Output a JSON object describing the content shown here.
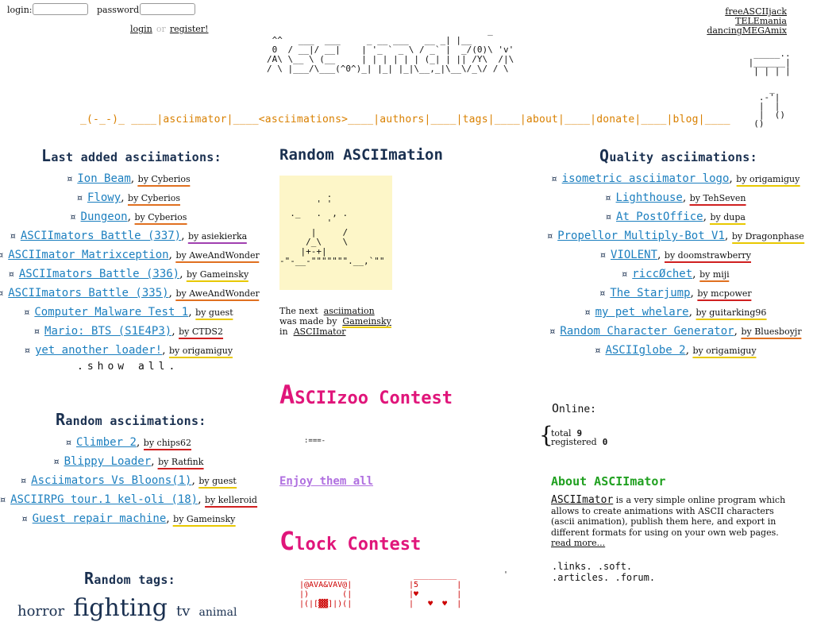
{
  "login": {
    "login_label": "login:",
    "password_label": "password:",
    "login_link": "login",
    "or_text": "or",
    "register_link": "register!"
  },
  "top_right_links": [
    "freeASCIIjack",
    "TELEmania",
    "dancingMEGAmix"
  ],
  "logo_art": "                                          _\n ^^   ___  ___     _ __ ___   __ _| |__\n 0  / __|/ __|    | '_ ` _ \\ / _` |  _/(0)\\ 'v'\n/A\\ \\__ \\ (__     | | | | | | (_| | || /Y\\  /|\\\n/ \\ |___/\\___(^0^)_| |_| |_|\\__,_|\\__\\/_\\/ / \\",
  "right_art": "  _____..\n |______|\n  | | | |\n\n     _\n   .-'|\n   |  |\n   |  ()\n  ()",
  "menu": {
    "face": "_(-_-)_",
    "sep": "____|",
    "items": [
      "asciimator|",
      "____<asciimations>",
      "____|authors|",
      "____|tags|",
      "____|about|",
      "____|donate|",
      "____|blog|",
      "____"
    ]
  },
  "last_added": {
    "heading_cap": "L",
    "heading_rest": "ast added asciimations:",
    "items": [
      {
        "title": "Ion Beam",
        "by": "by Cyberios"
      },
      {
        "title": "Flowy",
        "by": "by Cyberios"
      },
      {
        "title": "Dungeon",
        "by": "by Cyberios"
      },
      {
        "title": "ASCIImators Battle (337)",
        "by": "by asiekierka"
      },
      {
        "title": "ASCIImator Matrixception",
        "by": "by AweAndWonder"
      },
      {
        "title": "ASCIImators Battle (336)",
        "by": "by Gameinsky"
      },
      {
        "title": "ASCIImators Battle (335)",
        "by": "by AweAndWonder"
      },
      {
        "title": "Computer Malware Test 1",
        "by": "by guest"
      },
      {
        "title": "Mario: BTS (S1E4P3)",
        "by": "by CTDS2"
      },
      {
        "title": "yet another loader!",
        "by": "by origamiguy"
      }
    ],
    "show_all": ".show all."
  },
  "random_asciimations": {
    "heading_cap": "R",
    "heading_rest": "andom asciimations:",
    "items": [
      {
        "title": "Climber 2",
        "by": "by chips62"
      },
      {
        "title": "Blippy Loader",
        "by": "by Ratfink"
      },
      {
        "title": "Asciimators Vs Bloons(1)",
        "by": "by guest"
      },
      {
        "title": "ASCIIRPG tour.1 kel-oli (18)",
        "by": "by kelleroid"
      },
      {
        "title": "Guest repair machine",
        "by": "by Gameinsky"
      }
    ]
  },
  "random_tags": {
    "heading_cap": "R",
    "heading_rest": "andom tags:",
    "tags": [
      "horror",
      "fighting",
      "tv",
      "animal"
    ]
  },
  "random_asciimation": {
    "heading": "Random ASCIImation",
    "art": "\n         .\n       ' '\n  ._   .  , .\n         '\n      |     /\n     /_\\    \\\n    |+-+|\n-\"-__-\"\"\"\"\"\"\".__,`\"\"",
    "next_prefix": "The next",
    "next_link": "asciimation",
    "made_by_prefix": "was made by",
    "made_by_link": "Gameinsky",
    "in_prefix": "in",
    "in_link": "ASCIImator"
  },
  "zoo_contest": {
    "cap": "A",
    "rest": "SCIIzoo Contest",
    "art": ":===-",
    "enjoy": "Enjoy them all"
  },
  "clock_contest": {
    "cap": "C",
    "rest": "lock Contest",
    "art1": " _________\n|@AVA&VAV@|\n|)       (|\n|(|[▓▓]|)(|",
    "art2": " _________\n|5        |\n|♥        |\n|   ♥  ♥  |",
    "art3": "'"
  },
  "quality": {
    "heading_cap": "Q",
    "heading_rest": "uality asciimations:",
    "items": [
      {
        "title": "isometric asciimator logo",
        "by": "by origamiguy"
      },
      {
        "title": "Lighthouse",
        "by": "by TehSeven"
      },
      {
        "title": "At PostOffice",
        "by": "by dupa"
      },
      {
        "title": "Propellor Multiply-Bot V1",
        "by": "by Dragonphase"
      },
      {
        "title": "VIOLENT",
        "by": "by doomstrawberry"
      },
      {
        "title": "riccØchet",
        "by": "by miji"
      },
      {
        "title": "The Starjump",
        "by": "by mcpower"
      },
      {
        "title": "my pet whelare",
        "by": "by guitarking96"
      },
      {
        "title": "Random Character Generator",
        "by": "by Bluesboyjr"
      },
      {
        "title": "ASCIIglobe 2",
        "by": "by origamiguy"
      }
    ]
  },
  "online": {
    "cap": "O",
    "rest": "nline:",
    "brace": "{",
    "total_label": "total",
    "total_value": "9",
    "registered_label": "registered",
    "registered_value": "0"
  },
  "about": {
    "title": "About ASCIImator",
    "link": "ASCIImator",
    "text": " is a very simple online program which allows to create animations with ASCII characters (ascii animation), publish them here, and export in different formats for using on your own web pages. ",
    "read_more": "read more..."
  },
  "links": {
    "row1": [
      ".links.",
      ".soft."
    ],
    "row2": [
      ".articles.",
      ".forum."
    ]
  }
}
